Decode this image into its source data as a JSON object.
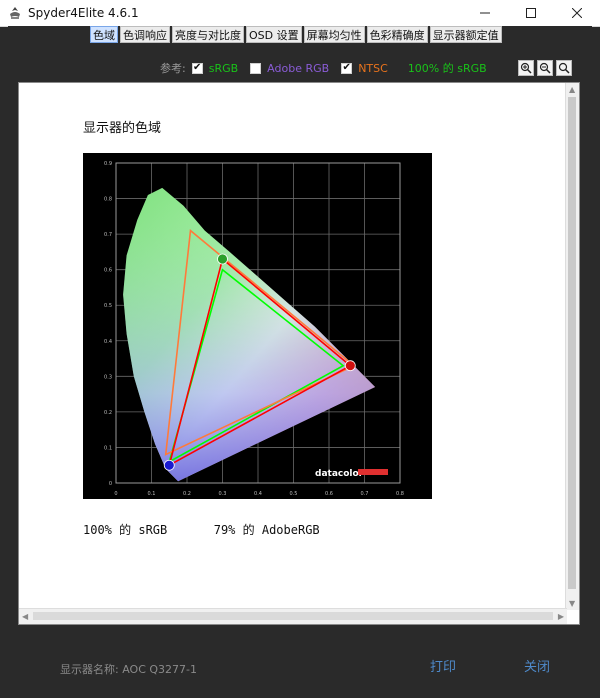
{
  "window": {
    "title": "Spyder4Elite 4.6.1"
  },
  "tabs": [
    {
      "label": "色域",
      "active": true
    },
    {
      "label": "色调响应"
    },
    {
      "label": "亮度与对比度"
    },
    {
      "label": "OSD 设置"
    },
    {
      "label": "屏幕均匀性"
    },
    {
      "label": "色彩精确度"
    },
    {
      "label": "显示器额定值"
    }
  ],
  "reference": {
    "label": "参考:",
    "items": [
      {
        "label": "sRGB",
        "checked": true,
        "color": "#19c219"
      },
      {
        "label": "Adobe RGB",
        "checked": false,
        "color": "#8a5cd6"
      },
      {
        "label": "NTSC",
        "checked": true,
        "color": "#e8731d"
      }
    ],
    "coverage": {
      "label": "100% 的 sRGB",
      "color": "#19c219"
    }
  },
  "icons": {
    "zoom_in": "zoom-in-icon",
    "zoom_out": "zoom-out-icon",
    "zoom_fit": "zoom-fit-icon"
  },
  "report": {
    "title": "显示器的色域",
    "summary_srgb": "100% 的 sRGB",
    "summary_adobe": "79% 的 AdobeRGB"
  },
  "chart_data": {
    "type": "scatter",
    "brand": "datacolor",
    "x_ticks": [
      "0",
      "0.1",
      "0.2",
      "0.3",
      "0.4",
      "0.5",
      "0.6",
      "0.7",
      "0.8"
    ],
    "y_ticks": [
      "0",
      "0.1",
      "0.2",
      "0.3",
      "0.4",
      "0.5",
      "0.6",
      "0.7",
      "0.8",
      "0.9"
    ],
    "xlim": [
      0,
      0.8
    ],
    "ylim": [
      0,
      0.9
    ],
    "grid": true,
    "series": [
      {
        "points": [
          [
            0.64,
            0.33
          ],
          [
            0.3,
            0.6
          ],
          [
            0.15,
            0.06
          ]
        ],
        "color": "#00ff00"
      },
      {
        "points": [
          [
            0.67,
            0.33
          ],
          [
            0.21,
            0.71
          ],
          [
            0.14,
            0.08
          ]
        ],
        "color": "#ff7a3a"
      },
      {
        "points": [
          [
            0.66,
            0.33
          ],
          [
            0.3,
            0.63
          ],
          [
            0.15,
            0.05
          ]
        ],
        "color": "#ff0000"
      }
    ],
    "primaries": [
      {
        "x": 0.66,
        "y": 0.33,
        "color": "#d01010"
      },
      {
        "x": 0.3,
        "y": 0.63,
        "color": "#2aa02a"
      },
      {
        "x": 0.15,
        "y": 0.05,
        "color": "#1a1ad0"
      }
    ]
  },
  "footer": {
    "display_label": "显示器名称: AOC Q3277-1",
    "print_button": "打印",
    "close_button": "关闭"
  }
}
